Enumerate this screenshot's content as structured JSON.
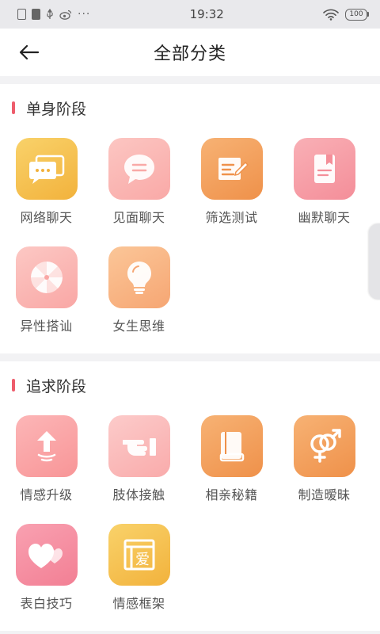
{
  "status_bar": {
    "time": "19:32",
    "battery": "100"
  },
  "nav": {
    "title": "全部分类"
  },
  "sections": [
    {
      "title": "单身阶段",
      "items": [
        {
          "label": "网络聊天",
          "icon": "chat-bubbles-icon",
          "color": "#f6c24e"
        },
        {
          "label": "见面聊天",
          "icon": "speech-bubble-icon",
          "color": "#fbb7b4"
        },
        {
          "label": "筛选测试",
          "icon": "checklist-edit-icon",
          "color": "#f3a05d"
        },
        {
          "label": "幽默聊天",
          "icon": "notebook-icon",
          "color": "#f7a0a8"
        },
        {
          "label": "异性搭讪",
          "icon": "pinwheel-icon",
          "color": "#fbbab7"
        },
        {
          "label": "女生思维",
          "icon": "lightbulb-icon",
          "color": "#f8b98a"
        }
      ]
    },
    {
      "title": "追求阶段",
      "items": [
        {
          "label": "情感升级",
          "icon": "arrow-up-icon",
          "color": "#fba7a9"
        },
        {
          "label": "肢体接触",
          "icon": "pointing-hand-icon",
          "color": "#fbbdbc"
        },
        {
          "label": "相亲秘籍",
          "icon": "book-icon",
          "color": "#f3a05d"
        },
        {
          "label": "制造暧昧",
          "icon": "gender-symbols-icon",
          "color": "#f3a05d"
        },
        {
          "label": "表白技巧",
          "icon": "hearts-icon",
          "color": "#f38fa1"
        },
        {
          "label": "情感框架",
          "icon": "love-frame-icon",
          "color": "#f6c24e"
        }
      ]
    }
  ]
}
